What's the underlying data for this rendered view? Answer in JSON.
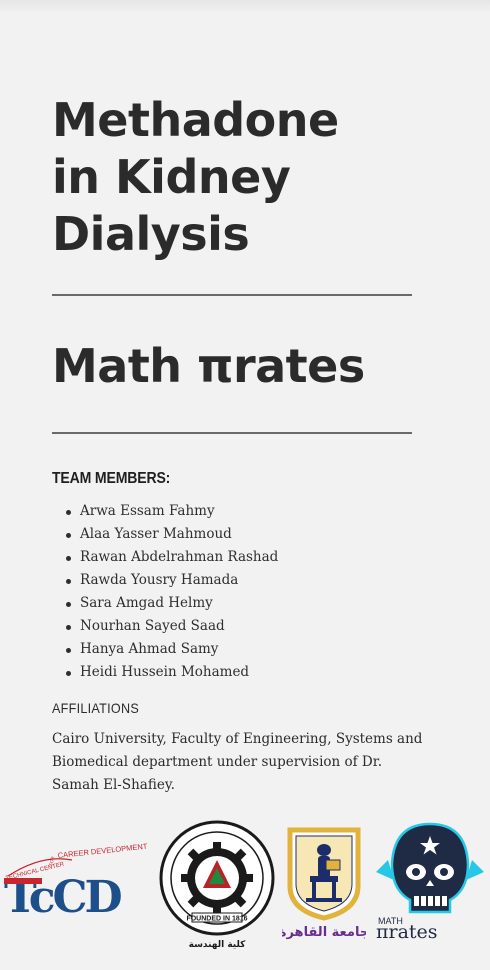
{
  "title_lines": [
    "Methadone",
    "in Kidney",
    "Dialysis"
  ],
  "team_name": "Math πrates",
  "team_heading": "TEAM MEMBERS:",
  "members": [
    "Arwa Essam Fahmy",
    "Alaa Yasser Mahmoud",
    "Rawan Abdelrahman Rashad",
    "Rawda Yousry Hamada",
    "Sara Amgad Helmy",
    "Nourhan Sayed Saad",
    "Hanya Ahmad Samy",
    "Heidi Hussein Mohamed"
  ],
  "affiliations_heading": "AFFILIATIONS",
  "affiliations_text": "Cairo University, Faculty of Engineering, Systems and Biomedical department under supervision of Dr. Samah El-Shafiey.",
  "logos": {
    "tccd": {
      "mark": "TcCD",
      "arc_left": "TECHNICAL CENTER",
      "arc_right": "CAREER DEVELOPMENT",
      "for_text": "FOR"
    },
    "seal": {
      "year_text": "FOUNDED IN 1816",
      "caption": "كلية الهندسة"
    },
    "cairo": {
      "caption": "جامعة القاهرة"
    },
    "mathpi": {
      "small": "MATH",
      "big": "πrates"
    }
  },
  "colors": {
    "text": "#2b2b2b",
    "rule": "#6a6a6a",
    "tccd_red": "#c8252f",
    "tccd_blue": "#1d4f8a",
    "seal_red": "#b8232a",
    "seal_green": "#1f8a3c",
    "cairo_gold": "#e2b33b",
    "cairo_navy": "#1d2d6b",
    "cairo_purple": "#6a2c8e",
    "mathpi_navy": "#1f2a44",
    "mathpi_cyan": "#27c7e8"
  }
}
